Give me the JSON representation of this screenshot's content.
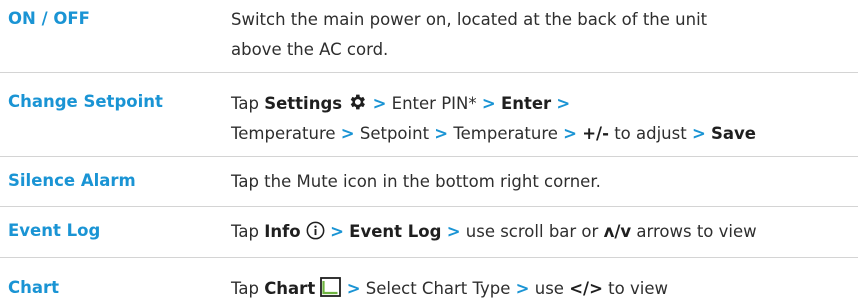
{
  "rows": [
    {
      "term": "ON / OFF",
      "desc_line1": "Switch the main power on, located at the back of the unit",
      "desc_line2": "above the AC cord."
    },
    {
      "term": "Change Setpoint",
      "tap": "Tap",
      "settings": "Settings",
      "icon": "gear-icon",
      "enter_pin": "Enter PIN*",
      "enter": "Enter",
      "temperature": "Temperature",
      "setpoint": "Setpoint",
      "temperature2": "Temperature",
      "plusminus": "+/-",
      "to_adjust": "to adjust",
      "save": "Save"
    },
    {
      "term": "Silence Alarm",
      "desc": "Tap the Mute icon in the bottom right corner."
    },
    {
      "term": "Event Log",
      "tap": "Tap",
      "info": "Info",
      "icon": "info-icon",
      "event_log": "Event Log",
      "use_scroll": "use scroll bar or",
      "arrows": "ʌ/v",
      "arrows_view": "arrows to view"
    },
    {
      "term": "Chart",
      "tap": "Tap",
      "chart": "Chart",
      "icon": "chart-icon",
      "select_type": "Select Chart Type",
      "use": "use",
      "lt_gt": "</>",
      "to_view": "to view"
    }
  ],
  "separator": ">",
  "colors": {
    "accent": "#1a94d4",
    "divider": "#d4d4d4",
    "text": "#2e2e2e"
  }
}
